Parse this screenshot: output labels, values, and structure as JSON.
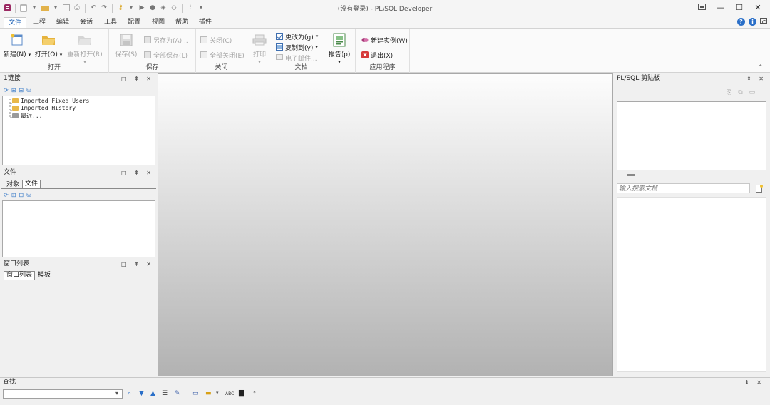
{
  "window": {
    "title": "(没有登录) - PL/SQL Developer",
    "controls": [
      "pin",
      "minimize",
      "maximize",
      "close"
    ]
  },
  "menu": {
    "tabs": [
      "文件",
      "工程",
      "编辑",
      "会话",
      "工具",
      "配置",
      "视图",
      "帮助",
      "插件"
    ],
    "active": "文件"
  },
  "ribbon": {
    "groups": {
      "open": {
        "label": "打开",
        "new": "新建(N)",
        "open": "打开(O)",
        "reopen": "重新打开(R)"
      },
      "save": {
        "label": "保存",
        "save": "保存(S)",
        "save_as": "另存为(A)...",
        "save_all": "全部保存(L)"
      },
      "close": {
        "label": "关闭",
        "close": "关闭(C)",
        "close_all": "全部关闭(E)"
      },
      "document": {
        "label": "文档",
        "print": "打印",
        "change_to": "更改为(g)",
        "copy_to": "复制到(y)",
        "email": "电子邮件...",
        "report": "报告(p)"
      },
      "app": {
        "label": "应用程序",
        "new_instance": "新建实例(W)",
        "exit": "退出(X)"
      }
    }
  },
  "panels": {
    "connections": {
      "title": "1链接",
      "items": [
        "Imported Fixed Users",
        "Imported History",
        "最近..."
      ]
    },
    "files": {
      "title": "文件",
      "tabs": [
        "对象",
        "文件"
      ],
      "active_tab": "文件"
    },
    "window_list": {
      "title": "窗口列表",
      "tabs": [
        "窗口列表",
        "模板"
      ],
      "active_tab": "窗口列表"
    },
    "clipboard": {
      "title": "PL/SQL 剪贴板",
      "search_placeholder": "输入搜索文档"
    }
  },
  "find": {
    "title": "查找",
    "value": ""
  }
}
